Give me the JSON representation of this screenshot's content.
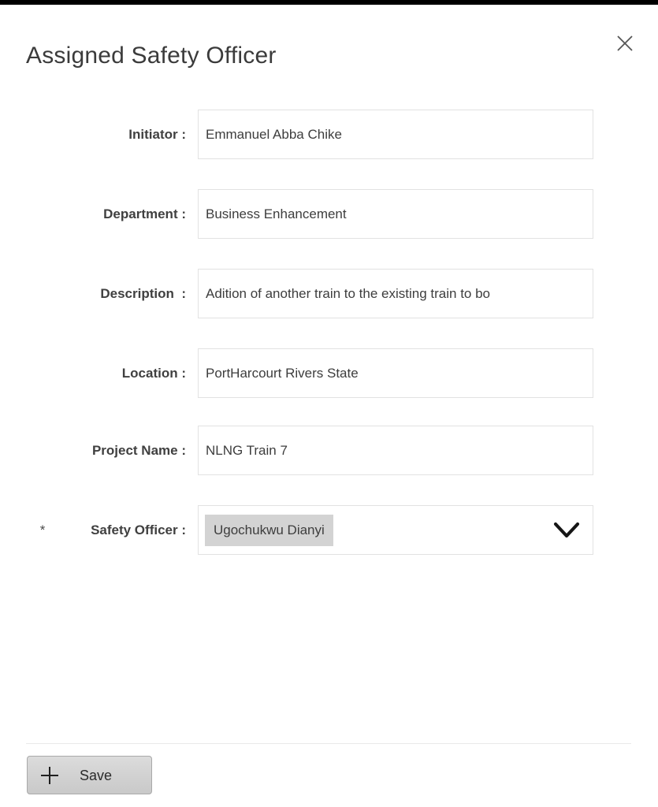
{
  "window": {
    "title": "Assigned Safety Officer",
    "close_icon": "close-icon"
  },
  "form": {
    "rows": [
      {
        "label": "Initiator :",
        "value": "Emmanuel Abba Chike",
        "required": "",
        "type": "text"
      },
      {
        "label": "Department :",
        "value": "Business Enhancement",
        "required": "",
        "type": "text"
      },
      {
        "label": "Description  :",
        "value": "Adition of another train to the existing train to bo",
        "required": "",
        "type": "text"
      },
      {
        "label": "Location :",
        "value": "PortHarcourt Rivers State",
        "required": "",
        "type": "text"
      },
      {
        "label": "Project Name :",
        "value": "NLNG Train 7",
        "required": "",
        "type": "text"
      },
      {
        "label": "Safety Officer :",
        "value": "Ugochukwu Dianyi",
        "required": "*",
        "type": "dropdown",
        "arrow_icon": "chevron-down-icon"
      }
    ]
  },
  "footer": {
    "save_label": "Save",
    "save_icon": "plus-icon"
  },
  "colors": {
    "title_text": "#3b3b3b",
    "label_text": "#404040",
    "value_text": "#3d3d3d",
    "field_border": "#e2e2e2",
    "chip_background": "#d3d3d3",
    "button_border": "#a9a9a9",
    "divider": "#e9e9e9",
    "topbar": "#000000"
  }
}
